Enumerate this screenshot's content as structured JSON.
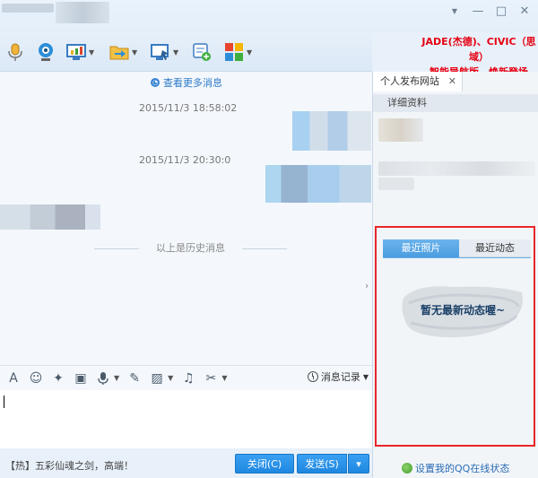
{
  "window": {
    "controls": {
      "menu_glyph": "▼",
      "minimize_glyph": "—",
      "maximize_glyph": "□",
      "close_glyph": "✕"
    }
  },
  "toolbar": {
    "buttons": [
      {
        "name": "microphone-icon",
        "has_dropdown": false
      },
      {
        "name": "webcam-icon",
        "has_dropdown": false
      },
      {
        "name": "screen-share-icon",
        "has_dropdown": true
      },
      {
        "name": "send-file-icon",
        "has_dropdown": true
      },
      {
        "name": "remote-assist-icon",
        "has_dropdown": true
      },
      {
        "name": "add-contact-icon",
        "has_dropdown": false
      },
      {
        "name": "apps-grid-icon",
        "has_dropdown": true
      }
    ]
  },
  "promo": {
    "line1": "JADE(杰德)、CIVIC（思域）",
    "line2": "智能导航版，焕新登场",
    "color": "#e60012"
  },
  "chat": {
    "view_more": "查看更多消息",
    "messages": [
      {
        "timestamp": "2015/11/3 18:58:02"
      },
      {
        "timestamp": "2015/11/3 20:30:0"
      }
    ],
    "history_divider": "以上是历史消息"
  },
  "editbar": {
    "tools": [
      {
        "name": "font-icon",
        "glyph": "A"
      },
      {
        "name": "emoji-icon",
        "glyph": "☺"
      },
      {
        "name": "magic-wand-icon",
        "glyph": "✦"
      },
      {
        "name": "gif-icon",
        "glyph": "▣"
      },
      {
        "name": "voice-message-icon",
        "glyph": "🎙"
      },
      {
        "name": "edit-icon",
        "glyph": "✎"
      },
      {
        "name": "image-icon",
        "glyph": "▨"
      },
      {
        "name": "music-icon",
        "glyph": "♫"
      },
      {
        "name": "screenshot-scissors-icon",
        "glyph": "✂"
      }
    ],
    "history_label": "消息记录"
  },
  "bottom": {
    "ad_prefix": "【热】",
    "ad_text": "五彩仙魂之剑，高端！",
    "close_label": "关闭(C)",
    "send_label": "发送(S)",
    "send_dropdown_glyph": "▾"
  },
  "right_panel": {
    "tab_label": "个人发布网站",
    "tab_close_glyph": "✕",
    "sub_label": "详细资料",
    "photo_tabs": [
      "最近照片",
      "最近动态"
    ],
    "empty_text": "暂无最新动态喔~",
    "qq_status_link": "设置我的QQ在线状态"
  },
  "colors": {
    "accent": "#1e87e0",
    "highlight_box": "#e8262a"
  }
}
